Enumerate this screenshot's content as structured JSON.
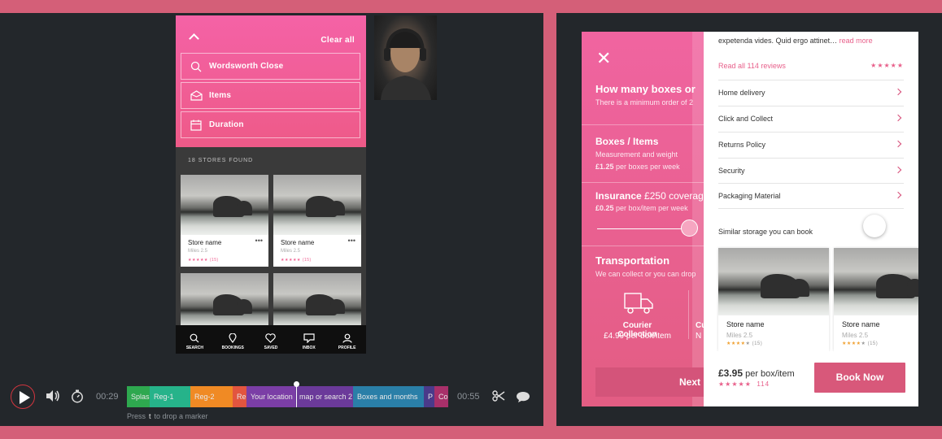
{
  "phone1": {
    "clear_all": "Clear all",
    "fields": [
      "Wordsworth Close",
      "Items",
      "Duration"
    ],
    "stores_found": "18 STORES FOUND",
    "cards": [
      {
        "name": "Store name",
        "miles": "Miles 2.5",
        "stars": "★★★★★",
        "count": "(15)"
      },
      {
        "name": "Store name",
        "miles": "Miles 2.5",
        "stars": "★★★★★",
        "count": "(15)"
      }
    ],
    "tabs": [
      "SEARCH",
      "BOOKINGS",
      "SAVED",
      "INBOX",
      "PROFILE"
    ]
  },
  "player": {
    "current_time": "00:29",
    "end_time": "00:55",
    "segments": [
      {
        "label": "Splas",
        "color": "#2ea84f"
      },
      {
        "label": "Reg-1",
        "color": "#26b38a"
      },
      {
        "label": "Reg-2",
        "color": "#f08a24"
      },
      {
        "label": "Re",
        "color": "#e2553f"
      },
      {
        "label": "Your location",
        "color": "#7b3ea6"
      },
      {
        "label": "map or search 2",
        "color": "#6b3a9a"
      },
      {
        "label": "Boxes and months",
        "color": "#2a7fa8"
      },
      {
        "label": "P",
        "color": "#4a3a8a"
      },
      {
        "label": "Co",
        "color": "#a8306a"
      }
    ],
    "hint_prefix": "Press",
    "hint_key": "t",
    "hint_suffix": "to drop a marker"
  },
  "app2": {
    "q_title": "How many boxes or",
    "q_sub": "There is a minimum order of 2",
    "boxes_title": "Boxes / Items",
    "boxes_sub": "Measurement and weight",
    "boxes_price": "£1.25",
    "boxes_price_suffix": "per boxes per week",
    "ins_title": "Insurance",
    "ins_amount": "£250 coverag",
    "ins_price": "£0.25",
    "ins_price_suffix": "per box/item per week",
    "trans_title": "Transportation",
    "trans_sub": "We can collect or you can drop",
    "courier_title": "Courier Collection",
    "courier_price": "£4.99 per box/item",
    "cut_title": "Cu",
    "cut_sub": "N",
    "next_label": "Next"
  },
  "sheet": {
    "desc": "expetenda vides. Quid ergo attinet…",
    "read_more": "read more",
    "read_reviews": "Read all 114 reviews",
    "stars": "★★★★★",
    "menu": [
      "Home delivery",
      "Click and Collect",
      "Returns Policy",
      "Security",
      "Packaging Material"
    ],
    "similar_title": "Similar storage you can book",
    "cards": [
      {
        "name": "Store name",
        "miles": "Miles 2.5",
        "stars": "★★★★",
        "empty_star": "★",
        "count": "(15)"
      },
      {
        "name": "Store name",
        "miles": "Miles 2.5",
        "stars": "★★★★",
        "empty_star": "★",
        "count": "(15)"
      }
    ],
    "price": "£3.95",
    "price_suffix": "per box/item",
    "price_stars": "★★★★★",
    "price_count": "114",
    "book_label": "Book Now"
  }
}
